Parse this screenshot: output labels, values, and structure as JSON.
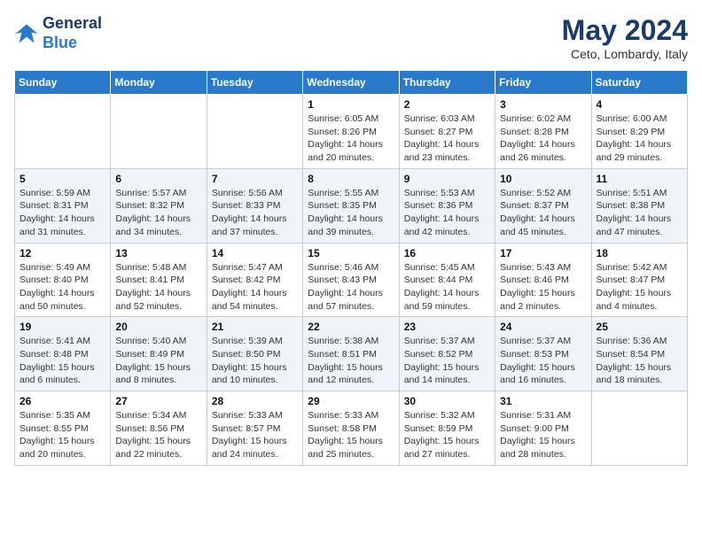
{
  "header": {
    "logo_line1": "General",
    "logo_line2": "Blue",
    "main_title": "May 2024",
    "subtitle": "Ceto, Lombardy, Italy"
  },
  "days_of_week": [
    "Sunday",
    "Monday",
    "Tuesday",
    "Wednesday",
    "Thursday",
    "Friday",
    "Saturday"
  ],
  "weeks": [
    [
      {
        "day": "",
        "info": ""
      },
      {
        "day": "",
        "info": ""
      },
      {
        "day": "",
        "info": ""
      },
      {
        "day": "1",
        "info": "Sunrise: 6:05 AM\nSunset: 8:26 PM\nDaylight: 14 hours\nand 20 minutes."
      },
      {
        "day": "2",
        "info": "Sunrise: 6:03 AM\nSunset: 8:27 PM\nDaylight: 14 hours\nand 23 minutes."
      },
      {
        "day": "3",
        "info": "Sunrise: 6:02 AM\nSunset: 8:28 PM\nDaylight: 14 hours\nand 26 minutes."
      },
      {
        "day": "4",
        "info": "Sunrise: 6:00 AM\nSunset: 8:29 PM\nDaylight: 14 hours\nand 29 minutes."
      }
    ],
    [
      {
        "day": "5",
        "info": "Sunrise: 5:59 AM\nSunset: 8:31 PM\nDaylight: 14 hours\nand 31 minutes."
      },
      {
        "day": "6",
        "info": "Sunrise: 5:57 AM\nSunset: 8:32 PM\nDaylight: 14 hours\nand 34 minutes."
      },
      {
        "day": "7",
        "info": "Sunrise: 5:56 AM\nSunset: 8:33 PM\nDaylight: 14 hours\nand 37 minutes."
      },
      {
        "day": "8",
        "info": "Sunrise: 5:55 AM\nSunset: 8:35 PM\nDaylight: 14 hours\nand 39 minutes."
      },
      {
        "day": "9",
        "info": "Sunrise: 5:53 AM\nSunset: 8:36 PM\nDaylight: 14 hours\nand 42 minutes."
      },
      {
        "day": "10",
        "info": "Sunrise: 5:52 AM\nSunset: 8:37 PM\nDaylight: 14 hours\nand 45 minutes."
      },
      {
        "day": "11",
        "info": "Sunrise: 5:51 AM\nSunset: 8:38 PM\nDaylight: 14 hours\nand 47 minutes."
      }
    ],
    [
      {
        "day": "12",
        "info": "Sunrise: 5:49 AM\nSunset: 8:40 PM\nDaylight: 14 hours\nand 50 minutes."
      },
      {
        "day": "13",
        "info": "Sunrise: 5:48 AM\nSunset: 8:41 PM\nDaylight: 14 hours\nand 52 minutes."
      },
      {
        "day": "14",
        "info": "Sunrise: 5:47 AM\nSunset: 8:42 PM\nDaylight: 14 hours\nand 54 minutes."
      },
      {
        "day": "15",
        "info": "Sunrise: 5:46 AM\nSunset: 8:43 PM\nDaylight: 14 hours\nand 57 minutes."
      },
      {
        "day": "16",
        "info": "Sunrise: 5:45 AM\nSunset: 8:44 PM\nDaylight: 14 hours\nand 59 minutes."
      },
      {
        "day": "17",
        "info": "Sunrise: 5:43 AM\nSunset: 8:46 PM\nDaylight: 15 hours\nand 2 minutes."
      },
      {
        "day": "18",
        "info": "Sunrise: 5:42 AM\nSunset: 8:47 PM\nDaylight: 15 hours\nand 4 minutes."
      }
    ],
    [
      {
        "day": "19",
        "info": "Sunrise: 5:41 AM\nSunset: 8:48 PM\nDaylight: 15 hours\nand 6 minutes."
      },
      {
        "day": "20",
        "info": "Sunrise: 5:40 AM\nSunset: 8:49 PM\nDaylight: 15 hours\nand 8 minutes."
      },
      {
        "day": "21",
        "info": "Sunrise: 5:39 AM\nSunset: 8:50 PM\nDaylight: 15 hours\nand 10 minutes."
      },
      {
        "day": "22",
        "info": "Sunrise: 5:38 AM\nSunset: 8:51 PM\nDaylight: 15 hours\nand 12 minutes."
      },
      {
        "day": "23",
        "info": "Sunrise: 5:37 AM\nSunset: 8:52 PM\nDaylight: 15 hours\nand 14 minutes."
      },
      {
        "day": "24",
        "info": "Sunrise: 5:37 AM\nSunset: 8:53 PM\nDaylight: 15 hours\nand 16 minutes."
      },
      {
        "day": "25",
        "info": "Sunrise: 5:36 AM\nSunset: 8:54 PM\nDaylight: 15 hours\nand 18 minutes."
      }
    ],
    [
      {
        "day": "26",
        "info": "Sunrise: 5:35 AM\nSunset: 8:55 PM\nDaylight: 15 hours\nand 20 minutes."
      },
      {
        "day": "27",
        "info": "Sunrise: 5:34 AM\nSunset: 8:56 PM\nDaylight: 15 hours\nand 22 minutes."
      },
      {
        "day": "28",
        "info": "Sunrise: 5:33 AM\nSunset: 8:57 PM\nDaylight: 15 hours\nand 24 minutes."
      },
      {
        "day": "29",
        "info": "Sunrise: 5:33 AM\nSunset: 8:58 PM\nDaylight: 15 hours\nand 25 minutes."
      },
      {
        "day": "30",
        "info": "Sunrise: 5:32 AM\nSunset: 8:59 PM\nDaylight: 15 hours\nand 27 minutes."
      },
      {
        "day": "31",
        "info": "Sunrise: 5:31 AM\nSunset: 9:00 PM\nDaylight: 15 hours\nand 28 minutes."
      },
      {
        "day": "",
        "info": ""
      }
    ]
  ]
}
